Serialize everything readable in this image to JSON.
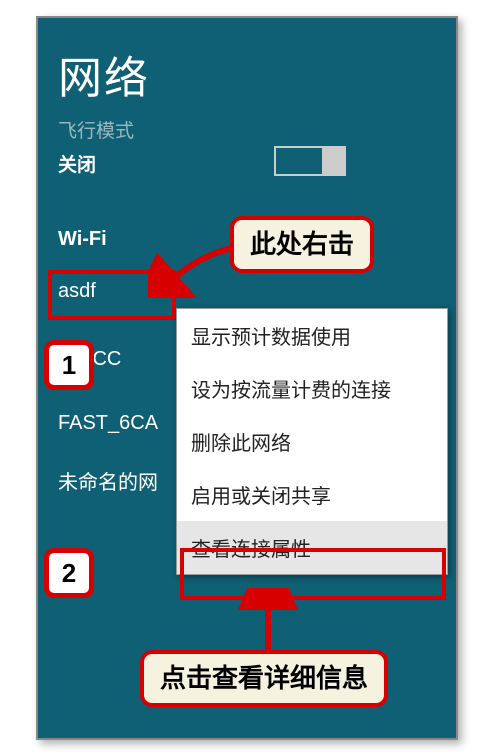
{
  "panel": {
    "title": "网络",
    "airplane_mode_label": "飞行模式",
    "airplane_mode_status": "关闭",
    "wifi_section_label": "Wi-Fi",
    "networks": [
      "asdf",
      "T_1CC",
      "FAST_6CA",
      "未命名的网"
    ]
  },
  "context_menu": {
    "items": [
      "显示预计数据使用",
      "设为按流量计费的连接",
      "删除此网络",
      "启用或关闭共享",
      "查看连接属性"
    ]
  },
  "annotations": {
    "callout_right_click": "此处右击",
    "callout_view_details": "点击查看详细信息",
    "step1": "1",
    "step2": "2"
  },
  "colors": {
    "panel_bg": "#0f6074",
    "highlight_red": "#d60000",
    "callout_bg": "#f5f3e0"
  }
}
